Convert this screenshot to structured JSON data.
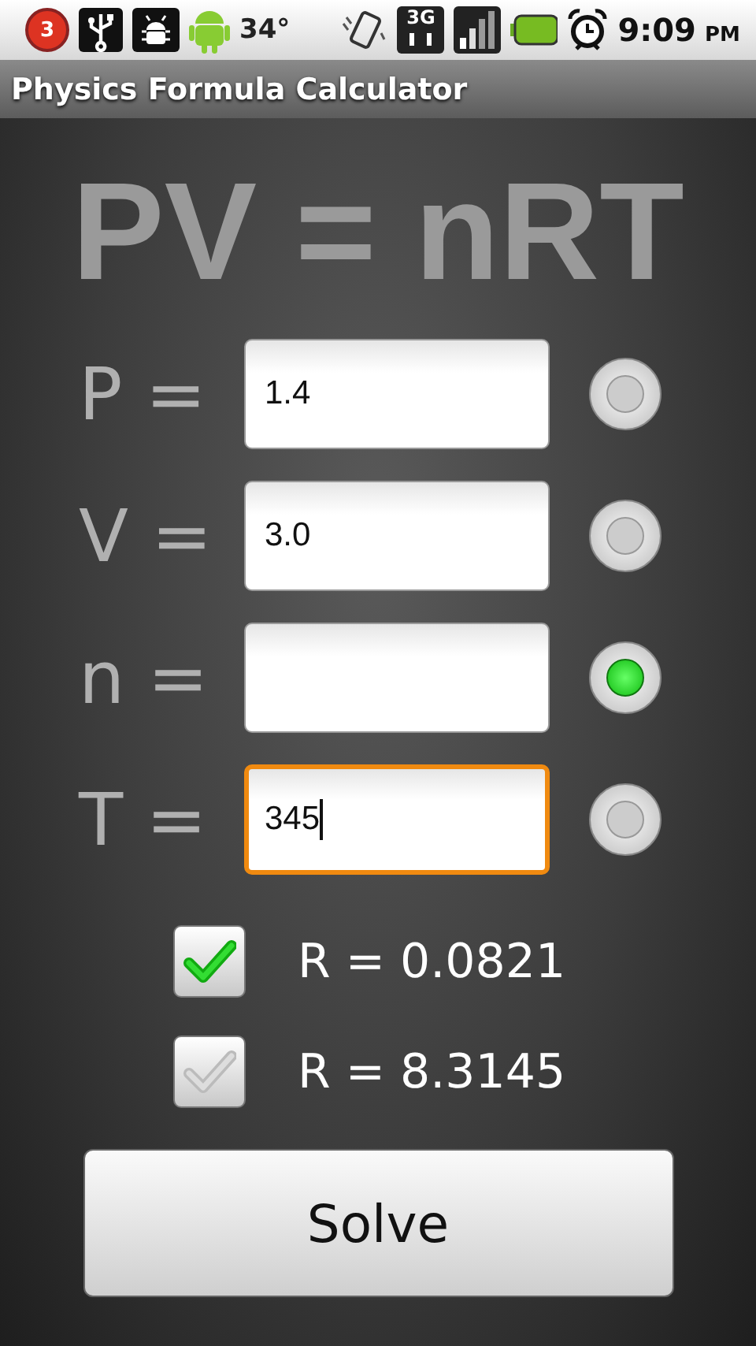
{
  "status_bar": {
    "notification_count": "3",
    "temperature": "34°",
    "network": "3G",
    "time": "9:09",
    "meridiem": "PM"
  },
  "app_bar": {
    "title": "Physics Formula Calculator"
  },
  "formula": "PV = nRT",
  "variables": [
    {
      "label": "P =",
      "value": "1.4",
      "focused": false,
      "selected": false
    },
    {
      "label": "V =",
      "value": "3.0",
      "focused": false,
      "selected": false
    },
    {
      "label": "n =",
      "focused": false,
      "selected": true
    },
    {
      "label": "T =",
      "value": "345",
      "focused": true,
      "selected": false
    }
  ],
  "constants": [
    {
      "label": "R = 0.0821",
      "checked": true
    },
    {
      "label": "R = 8.3145",
      "checked": false
    }
  ],
  "solve_button": "Solve"
}
